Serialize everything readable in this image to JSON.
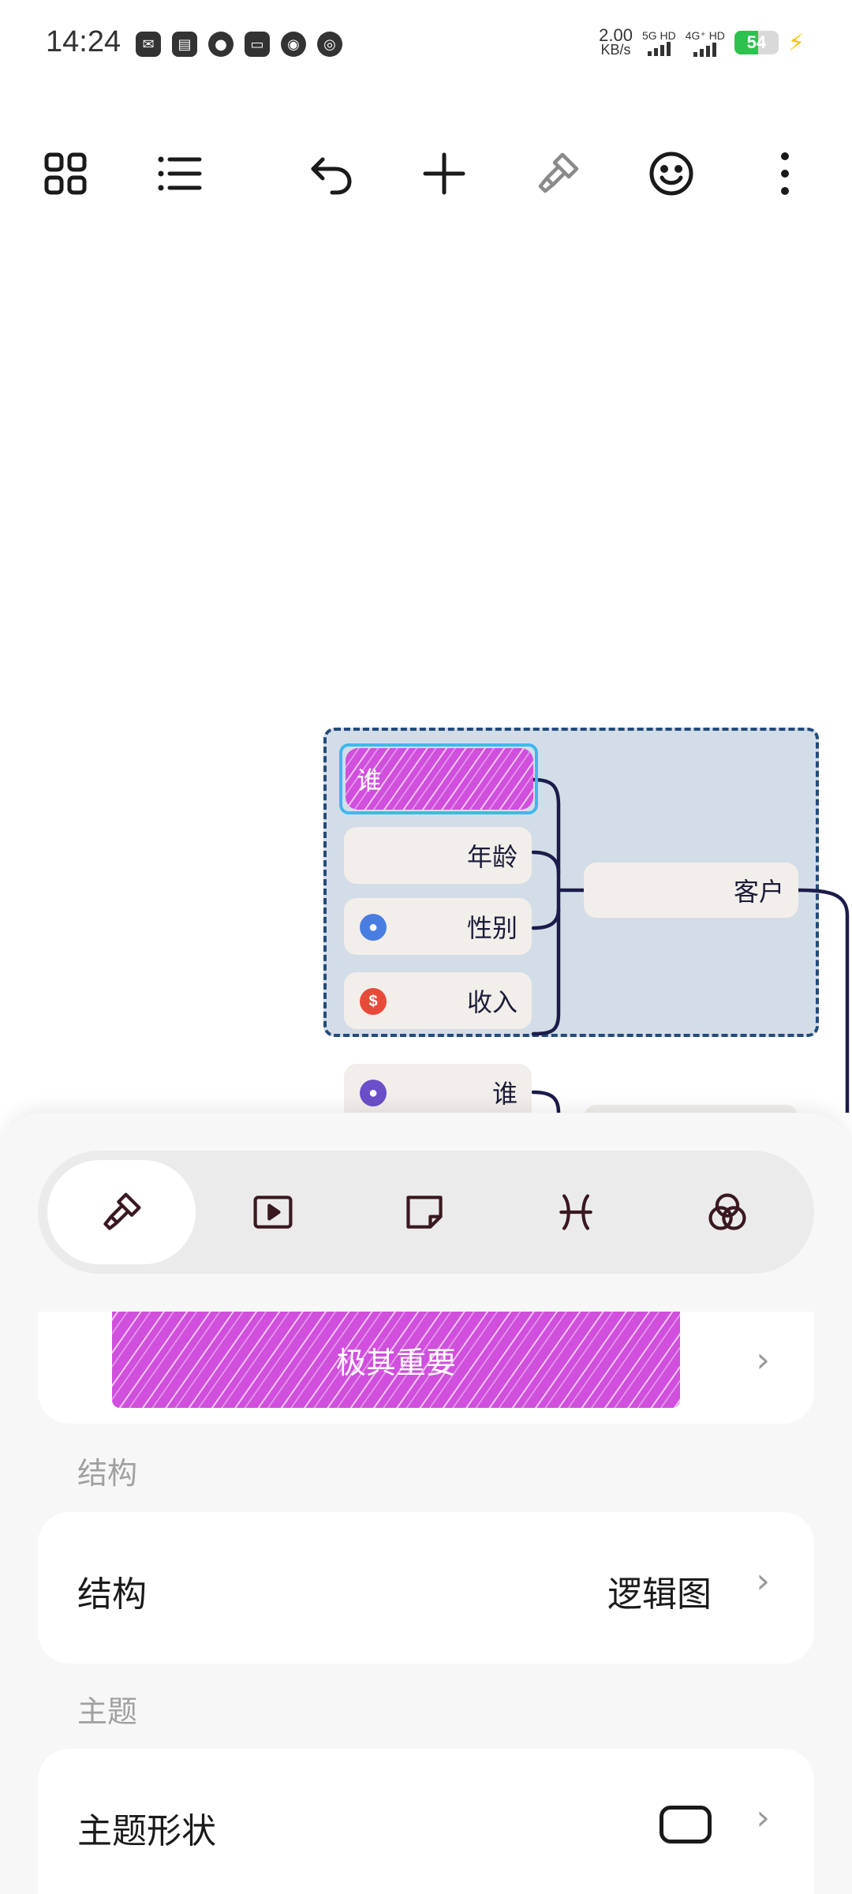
{
  "status_bar": {
    "time": "14:24",
    "net_speed_value": "2.00",
    "net_speed_unit": "KB/s",
    "sim1_label": "5G HD",
    "sim2_label": "4G⁺ HD",
    "battery": "54"
  },
  "mindmap": {
    "group_nodes": [
      {
        "label": "谁"
      },
      {
        "label": "年龄"
      },
      {
        "label": "性别"
      },
      {
        "label": "收入"
      }
    ],
    "parent_node": "客户",
    "next_node": "谁"
  },
  "sheet": {
    "style_label": "极其重要",
    "section_structure": "结构",
    "structure_row_title": "结构",
    "structure_row_value": "逻辑图",
    "section_topic": "主题",
    "topic_shape_title": "主题形状"
  },
  "colors": {
    "highlight": "#d04fdc",
    "group_fill": "#d3dde8",
    "group_border": "#234a7a",
    "selection": "#3fb8ee",
    "connector": "#1c1c4a"
  }
}
